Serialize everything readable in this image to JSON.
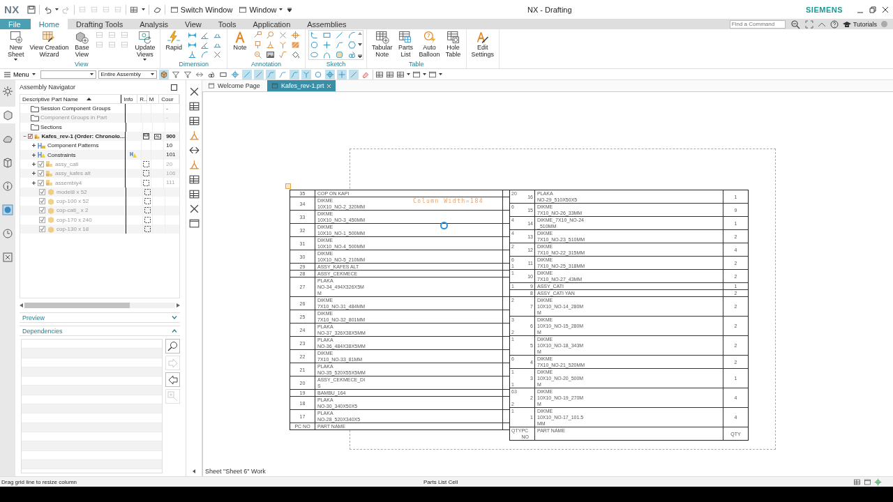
{
  "title_bar": {
    "logo": "NX",
    "quick_access": [
      {
        "label": "Switch Window",
        "menu": false
      },
      {
        "label": "Window",
        "menu": true
      }
    ],
    "title": "NX - Drafting",
    "brand": "SIEMENS"
  },
  "ribbon": {
    "tabs": [
      {
        "label": "File",
        "kind": "file",
        "selected": false
      },
      {
        "label": "Home",
        "kind": "tab",
        "selected": true
      },
      {
        "label": "Drafting Tools",
        "kind": "tab",
        "selected": false
      },
      {
        "label": "Analysis",
        "kind": "tab",
        "selected": false
      },
      {
        "label": "View",
        "kind": "tab",
        "selected": false
      },
      {
        "label": "Tools",
        "kind": "tab",
        "selected": false
      },
      {
        "label": "Application",
        "kind": "tab",
        "selected": false
      },
      {
        "label": "Assemblies",
        "kind": "tab",
        "selected": false
      }
    ],
    "search": {
      "placeholder": "Find a Command"
    },
    "help": "Tutorials",
    "groups": [
      {
        "label": "View",
        "items": [
          {
            "kind": "big",
            "label": "New\nSheet",
            "menu": true
          },
          {
            "kind": "big",
            "label": "View Creation\nWizard",
            "menu": false
          },
          {
            "kind": "big",
            "label": "Base\nView",
            "menu": false
          },
          {
            "kind": "small",
            "disabled": true
          },
          {
            "kind": "big",
            "label": "Update\nViews",
            "menu": true
          }
        ]
      },
      {
        "label": "Dimension",
        "items": [
          {
            "kind": "big",
            "label": "Rapid",
            "menu": false
          },
          {
            "kind": "small",
            "disabled": false
          }
        ]
      },
      {
        "label": "Annotation",
        "items": [
          {
            "kind": "big",
            "label": "Note",
            "menu": false
          },
          {
            "kind": "small",
            "disabled": false
          }
        ]
      },
      {
        "label": "Sketch",
        "items": [
          {
            "kind": "gallery"
          }
        ]
      },
      {
        "label": "Table",
        "items": [
          {
            "kind": "big",
            "label": "Tabular\nNote",
            "menu": false
          },
          {
            "kind": "big",
            "label": "Parts\nList",
            "menu": false
          },
          {
            "kind": "big",
            "label": "Auto\nBalloon",
            "menu": false
          },
          {
            "kind": "big",
            "label": "Hole\nTable",
            "menu": false
          }
        ]
      },
      {
        "items": [
          {
            "kind": "big",
            "label": "Edit\nSettings",
            "menu": false
          }
        ]
      }
    ]
  },
  "toolbar": {
    "menu": "Menu",
    "scope": "Entire Assembly",
    "toggles": [
      {
        "selected": true
      },
      {
        "selected": false
      },
      {
        "selected": false
      },
      {
        "selected": false
      },
      {
        "selected": false
      },
      {
        "selected": false
      },
      {
        "selected": false
      },
      {
        "selected": true
      },
      {
        "selected": true
      },
      {
        "selected": true
      },
      {
        "selected": false
      },
      {
        "selected": true
      },
      {
        "selected": true
      },
      {
        "selected": false
      },
      {
        "selected": true
      },
      {
        "selected": true
      },
      {
        "selected": true
      },
      {
        "selected": false
      }
    ]
  },
  "resource_bar": [
    {
      "selected": false
    },
    {
      "selected": true
    },
    {
      "selected": false
    },
    {
      "selected": false
    },
    {
      "selected": false
    },
    {
      "selected": false
    },
    {
      "selected": false
    },
    {
      "selected": false
    }
  ],
  "navigator": {
    "title": "Assembly Navigator",
    "columns": [
      "Descriptive Part Name",
      "Info",
      "R..",
      "M",
      "Cour"
    ],
    "rows": [
      {
        "name": "Session Component Groups",
        "kind": "folder",
        "count": "-",
        "dimmed": false
      },
      {
        "name": "Component Groups in Part",
        "kind": "folder",
        "count": "-",
        "dimmed": true
      },
      {
        "name": "Sections",
        "kind": "folder",
        "dimmed": false
      },
      {
        "name": "Kafes_rev-1 (Order: Chronolo...",
        "kind": "root",
        "count": "900",
        "dimmed": false,
        "checked": true,
        "expanded": true,
        "saved": true,
        "modified": true,
        "children": [
          {
            "name": "Component Patterns",
            "kind": "pattern",
            "count": "10",
            "dimmed": false,
            "expanded": false
          },
          {
            "name": "Constraints",
            "kind": "constraint",
            "count": "101",
            "dimmed": false,
            "expanded": false,
            "warning": true
          },
          {
            "name": "assy_cati",
            "kind": "assembly",
            "count": "20",
            "dimmed": true,
            "checked": true,
            "expanded": false,
            "reference_only": true
          },
          {
            "name": "assy_kafes alt",
            "kind": "assembly",
            "count": "106",
            "dimmed": true,
            "checked": true,
            "expanded": false,
            "reference_only": true
          },
          {
            "name": "assembly4",
            "kind": "assembly",
            "count": "111",
            "dimmed": true,
            "checked": true,
            "expanded": false,
            "reference_only": true
          },
          {
            "name": "model8 x 52",
            "kind": "part",
            "dimmed": true,
            "checked": true,
            "reference_only": true
          },
          {
            "name": "cop-100 x 52",
            "kind": "part",
            "dimmed": true,
            "checked": true,
            "reference_only": true
          },
          {
            "name": "cop-cati_ x 2",
            "kind": "part",
            "dimmed": true,
            "checked": true,
            "reference_only": true
          },
          {
            "name": "cop-170 x 240",
            "kind": "part",
            "dimmed": true,
            "checked": true,
            "reference_only": true
          },
          {
            "name": "cop-130 x 18",
            "kind": "part",
            "dimmed": true,
            "checked": true,
            "reference_only": true
          }
        ]
      }
    ]
  },
  "preview": {
    "label": "Preview",
    "expanded": false
  },
  "dependencies": {
    "label": "Dependencies",
    "expanded": true,
    "tools": [
      {
        "disabled": false
      },
      {
        "disabled": true
      },
      {
        "disabled": false
      },
      {
        "disabled": true
      }
    ]
  },
  "canvas": {
    "tabs": [
      {
        "label": "Welcome Page",
        "selected": false
      },
      {
        "label": "Kafes_rev-1.prt",
        "selected": true
      }
    ],
    "hint": "Column Width=184",
    "parts_lists": [
      {
        "header": {
          "pc_no": "PC NO",
          "name": "PART NAME"
        },
        "rows": [
          {
            "pc_no": "35",
            "name": "COP ON KAPI"
          },
          {
            "pc_no": "34",
            "name": "DIKME\n10X10_NO-2_320MM"
          },
          {
            "pc_no": "33",
            "name": "DIKME\n10X10_NO-3_450MM"
          },
          {
            "pc_no": "32",
            "name": "DIKME\n10X10_NO-1_500MM"
          },
          {
            "pc_no": "31",
            "name": "DIKME\n10X10_NO-4_500MM"
          },
          {
            "pc_no": "30",
            "name": "DIKME\n10X10_NO-5_210MM"
          },
          {
            "pc_no": "29",
            "name": "ASSY_KAFES ALT"
          },
          {
            "pc_no": "28",
            "name": "ASSY_CEKMECE"
          },
          {
            "pc_no": "27",
            "name": "PLAKA\nNO-34_494X326X5M\nM"
          },
          {
            "pc_no": "26",
            "name": "DIKME\n7X10_NO-31_484MM"
          },
          {
            "pc_no": "25",
            "name": "DIKME\n7X10_NO-32_801MM"
          },
          {
            "pc_no": "24",
            "name": "PLAKA\nNO-37_326X38X5MM"
          },
          {
            "pc_no": "23",
            "name": "PLAKA\nNO-36_484X38X5MM"
          },
          {
            "pc_no": "22",
            "name": "DIKME\n7X10_NO-33_81MM"
          },
          {
            "pc_no": "21",
            "name": "PLAKA\nNO-35_520X55X5MM"
          },
          {
            "pc_no": "20",
            "name": "ASSY_CEKMECE_DI\nS"
          },
          {
            "pc_no": "19",
            "name": "BAMBU_164"
          },
          {
            "pc_no": "18",
            "name": "PLAKA\nNO-30_340X50X5"
          },
          {
            "pc_no": "17",
            "name": "PLAKA\nNO-28_520X340X5"
          }
        ]
      },
      {
        "header": {
          "pc_no": "PC NO",
          "name": "PART NAME",
          "qty": "QTY",
          "overlap": [
            "QTY"
          ]
        },
        "rows": [
          {
            "pc_no": "16",
            "name": "PLAKA\nNO-29_510X50X5",
            "qty": "1",
            "overlap": [
              "20"
            ]
          },
          {
            "pc_no": "15",
            "name": "DIKME\n7X10_NO-26_33MM",
            "qty": "9",
            "overlap": [
              "6"
            ]
          },
          {
            "pc_no": "14",
            "name": "DIKME_7X10_NO-24\n_510MM",
            "qty": "1",
            "overlap": [
              "4"
            ]
          },
          {
            "pc_no": "13",
            "name": "DIKME\n7X10_NO-23_510MM",
            "qty": "2",
            "overlap": [
              "4"
            ]
          },
          {
            "pc_no": "12",
            "name": "DIKME\n7X10_NO-22_315MM",
            "qty": "4",
            "overlap": [
              "2"
            ]
          },
          {
            "pc_no": "11",
            "name": "DIKME\n7X10_NO-25_318MM",
            "qty": "2",
            "overlap": [
              "6",
              "1"
            ]
          },
          {
            "pc_no": "10",
            "name": "DIKME\n7X10_NO-27_43MM",
            "qty": "2",
            "overlap": [
              "1"
            ]
          },
          {
            "pc_no": "9",
            "name": "ASSY_CATI",
            "qty": "1",
            "overlap": [
              "1"
            ]
          },
          {
            "pc_no": "8",
            "name": "ASSY_CATI YAN",
            "qty": "2"
          },
          {
            "pc_no": "7",
            "name": "DIKME\n10X10_NO-14_280M\nM",
            "qty": "2",
            "overlap": [
              "2"
            ]
          },
          {
            "pc_no": "6",
            "name": "DIKME\n10X10_NO-15_280M\nM",
            "qty": "2",
            "overlap": [
              "3",
              "2"
            ]
          },
          {
            "pc_no": "5",
            "name": "DIKME\n10X10_NO-18_343M\nM",
            "qty": "2",
            "overlap": [
              "1"
            ]
          },
          {
            "pc_no": "4",
            "name": "DIKME\n7X10_NO-21_520MM",
            "qty": "2",
            "overlap": [
              "6"
            ]
          },
          {
            "pc_no": "3",
            "name": "DIKME\n10X10_NO-20_500M\nM",
            "qty": "1",
            "overlap": [
              "1",
              "1"
            ]
          },
          {
            "pc_no": "2",
            "name": "DIKME\n10X10_NO-19_270M\nM",
            "qty": "4",
            "overlap": [
              "63",
              "2"
            ]
          },
          {
            "pc_no": "1",
            "name": "DIKME\n10X10_NO-17_101.5\nMM",
            "qty": "4",
            "overlap": [
              "1"
            ]
          }
        ]
      }
    ],
    "sheet_label": "Sheet \"Sheet 6\" Work"
  },
  "status_bar": {
    "message": "Drag grid line to resize column",
    "selection": "Parts List Cell"
  }
}
